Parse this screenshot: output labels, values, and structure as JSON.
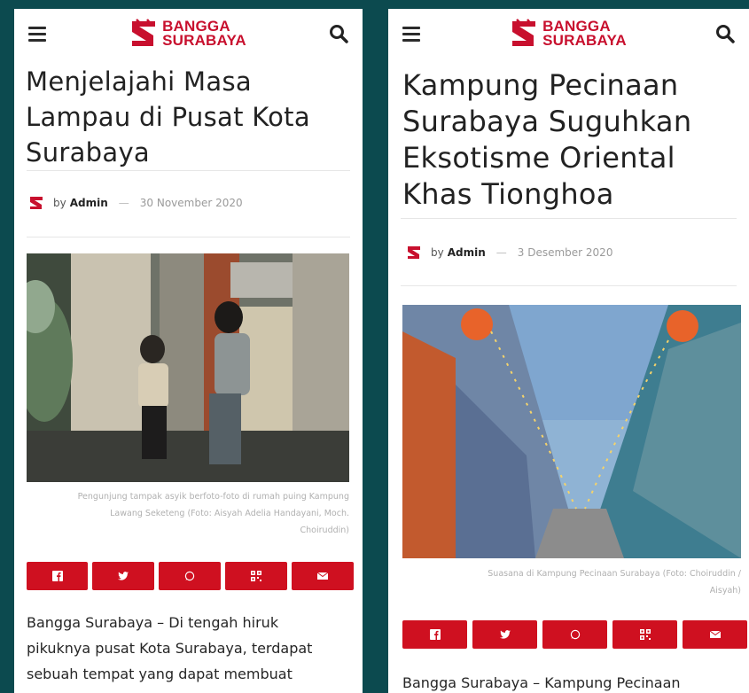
{
  "brand": {
    "line1": "BANGGA",
    "line2": "SURABAYA",
    "red": "#c8102e",
    "share_red": "#cf1020",
    "background": "#0c4a4f"
  },
  "articles": [
    {
      "title": "Menjelajahi Masa Lampau di Pusat Kota Surabaya",
      "by": "by",
      "author": "Admin",
      "dash": "—",
      "date": "30 November 2020",
      "caption": "Pengunjung tampak asyik berfoto-foto di rumah puing Kampung\nLawang Seketeng (Foto: Aisyah Adelia Handayani, Moch.\nChoiruddin)",
      "body": "Bangga Surabaya – Di tengah hiruk\npikuknya pusat Kota Surabaya, terdapat\nsebuah tempat yang dapat membuat"
    },
    {
      "title": "Kampung Pecinaan Surabaya Suguhkan Eksotisme Oriental Khas Tionghoa",
      "by": "by",
      "author": "Admin",
      "dash": "—",
      "date": "3 Desember 2020",
      "caption": "Suasana di Kampung Pecinaan Surabaya (Foto: Choiruddin /\nAisyah)",
      "body": "Bangga Surabaya – Kampung Pecinaan"
    }
  ],
  "share_icons": [
    "facebook-icon",
    "twitter-icon",
    "whatsapp-icon",
    "qr-code-icon",
    "email-icon"
  ]
}
